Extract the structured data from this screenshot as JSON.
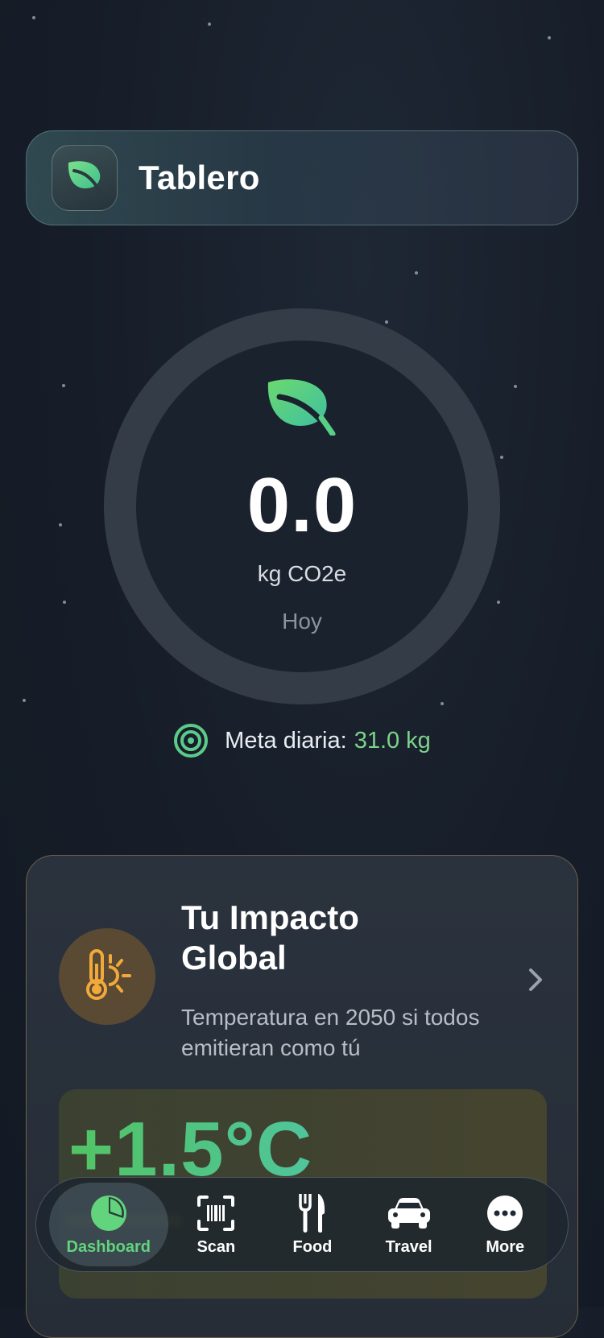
{
  "header": {
    "title": "Tablero",
    "icon": "leaf-icon"
  },
  "summary": {
    "value": "0.0",
    "unit": "kg CO2e",
    "period": "Hoy",
    "icon": "leaf-icon"
  },
  "goal": {
    "label": "Meta diaria:",
    "value": "31.0 kg",
    "icon": "target-icon"
  },
  "impact": {
    "title": "Tu Impacto Global",
    "subtitle": "Temperatura en 2050 si todos emitieran como tú",
    "icon": "thermometer-sun-icon",
    "temperature": "+1.5°C"
  },
  "tabs": [
    {
      "label": "Dashboard",
      "icon": "pie-chart-icon",
      "active": true
    },
    {
      "label": "Scan",
      "icon": "barcode-scan-icon",
      "active": false
    },
    {
      "label": "Food",
      "icon": "fork-knife-icon",
      "active": false
    },
    {
      "label": "Travel",
      "icon": "car-icon",
      "active": false
    },
    {
      "label": "More",
      "icon": "more-icon",
      "active": false
    }
  ],
  "colors": {
    "accent_green": "#62d47d",
    "goal_value": "#7dd38b",
    "warm_icon": "#f2a93b"
  }
}
